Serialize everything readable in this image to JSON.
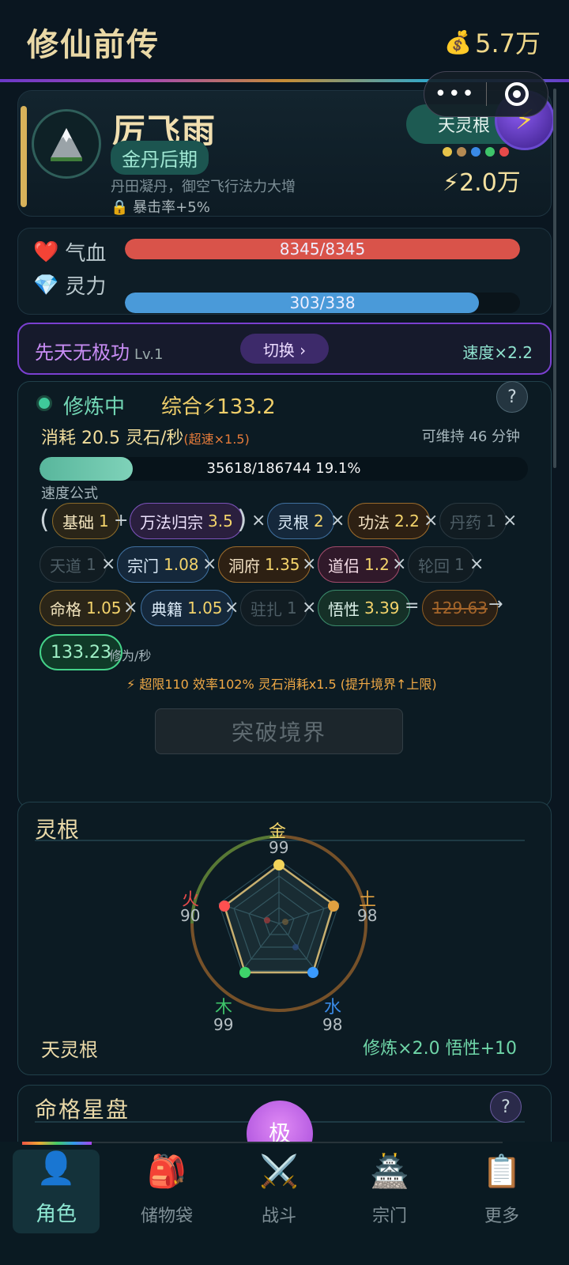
{
  "header": {
    "title": "修仙前传",
    "money": "5.7万",
    "money_icon": "money-bag-icon"
  },
  "miniprogram": {
    "dots": "•••"
  },
  "character": {
    "name": "厉飞雨",
    "realm": "金丹后期",
    "description": "丹田凝丹，御空飞行法力大增",
    "crit": "暴击率+5%",
    "root_label": "天灵根",
    "power": "2.0万",
    "element_colors": [
      "#e6c34a",
      "#b58a52",
      "#3a8ae6",
      "#3ec46a",
      "#e64a4a"
    ]
  },
  "stats": {
    "hp_label": "气血",
    "hp_value": "8345/8345",
    "hp_fraction": 1.0,
    "mp_label": "灵力",
    "mp_value": "303/338",
    "mp_fraction": 0.896
  },
  "skill": {
    "name": "先天无极功",
    "level": "Lv.1",
    "switch": "切换 ›",
    "speed": "速度×2.2"
  },
  "cultivation": {
    "status": "修炼中",
    "total": "综合⚡133.2",
    "consume": "消耗 20.5 灵石/秒",
    "overspeed": "(超速×1.5)",
    "maintain": "可维持 46 分钟",
    "progress_text": "35618/186744  19.1%",
    "progress_fraction": 0.191,
    "formula_label": "速度公式",
    "chips": [
      {
        "label": "基础",
        "value": "1"
      },
      {
        "label": "万法归宗",
        "value": "3.5"
      },
      {
        "label": "灵根",
        "value": "2"
      },
      {
        "label": "功法",
        "value": "2.2"
      },
      {
        "label": "丹药",
        "value": "1"
      },
      {
        "label": "天道",
        "value": "1"
      },
      {
        "label": "宗门",
        "value": "1.08"
      },
      {
        "label": "洞府",
        "value": "1.35"
      },
      {
        "label": "道侣",
        "value": "1.2"
      },
      {
        "label": "轮回",
        "value": "1"
      },
      {
        "label": "命格",
        "value": "1.05"
      },
      {
        "label": "典籍",
        "value": "1.05"
      },
      {
        "label": "驻扎",
        "value": "1"
      },
      {
        "label": "悟性",
        "value": "3.39"
      }
    ],
    "old_result": "129.63",
    "result": "133.23",
    "result_unit": "修为/秒",
    "note": "⚡ 超限110 效率102% 灵石消耗x1.5 (提升境界↑上限)",
    "breakthrough": "突破境界"
  },
  "spirit_root": {
    "title": "灵根",
    "elements": [
      {
        "name": "金",
        "value": "99",
        "color": "#e6c34a"
      },
      {
        "name": "土",
        "value": "98",
        "color": "#d4983a"
      },
      {
        "name": "水",
        "value": "98",
        "color": "#3a8ae6"
      },
      {
        "name": "木",
        "value": "99",
        "color": "#3ec46a"
      },
      {
        "name": "火",
        "value": "90",
        "color": "#e64a4a"
      }
    ],
    "root_type": "天灵根",
    "bonus": "修炼×2.0  悟性+10"
  },
  "fate": {
    "title": "命格星盘",
    "orb": "极"
  },
  "tabs": [
    {
      "label": "角色",
      "icon": "person-icon"
    },
    {
      "label": "储物袋",
      "icon": "backpack-icon"
    },
    {
      "label": "战斗",
      "icon": "crossed-swords-icon"
    },
    {
      "label": "宗门",
      "icon": "pagoda-icon"
    },
    {
      "label": "更多",
      "icon": "clipboard-icon"
    }
  ]
}
